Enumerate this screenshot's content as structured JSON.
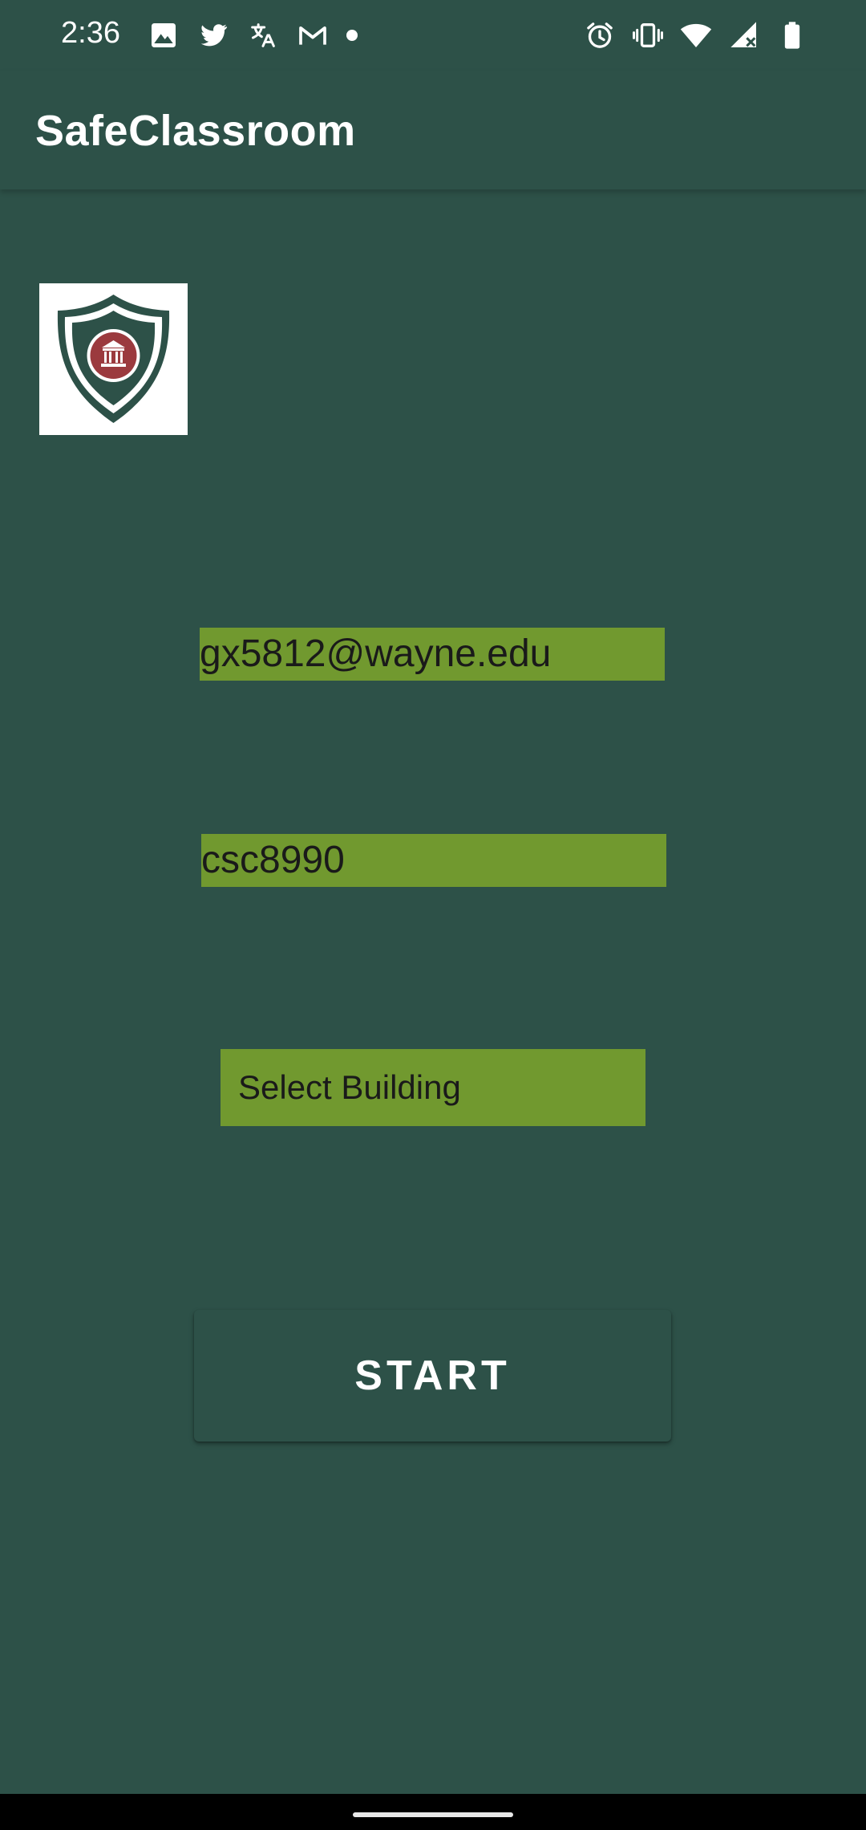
{
  "status_bar": {
    "time": "2:36",
    "left_icons": [
      "image-icon",
      "twitter-icon",
      "translate-icon",
      "gmail-icon",
      "notification-dot-icon"
    ],
    "right_icons": [
      "alarm-icon",
      "vibrate-icon",
      "wifi-icon",
      "signal-icon",
      "battery-icon"
    ]
  },
  "app_bar": {
    "title": "SafeClassroom"
  },
  "logo": {
    "icon": "shield-building-logo",
    "colors": {
      "shield": "#2d5148",
      "emblem": "#9b3a3e"
    }
  },
  "form": {
    "email_value": "gx5812@wayne.edu",
    "password_value": "csc8990",
    "building_placeholder": "Select Building",
    "start_label": "START"
  },
  "colors": {
    "background": "#2d5148",
    "field_bg": "#71992f",
    "text_light": "#ffffff",
    "text_dark": "#1a1a1a"
  }
}
